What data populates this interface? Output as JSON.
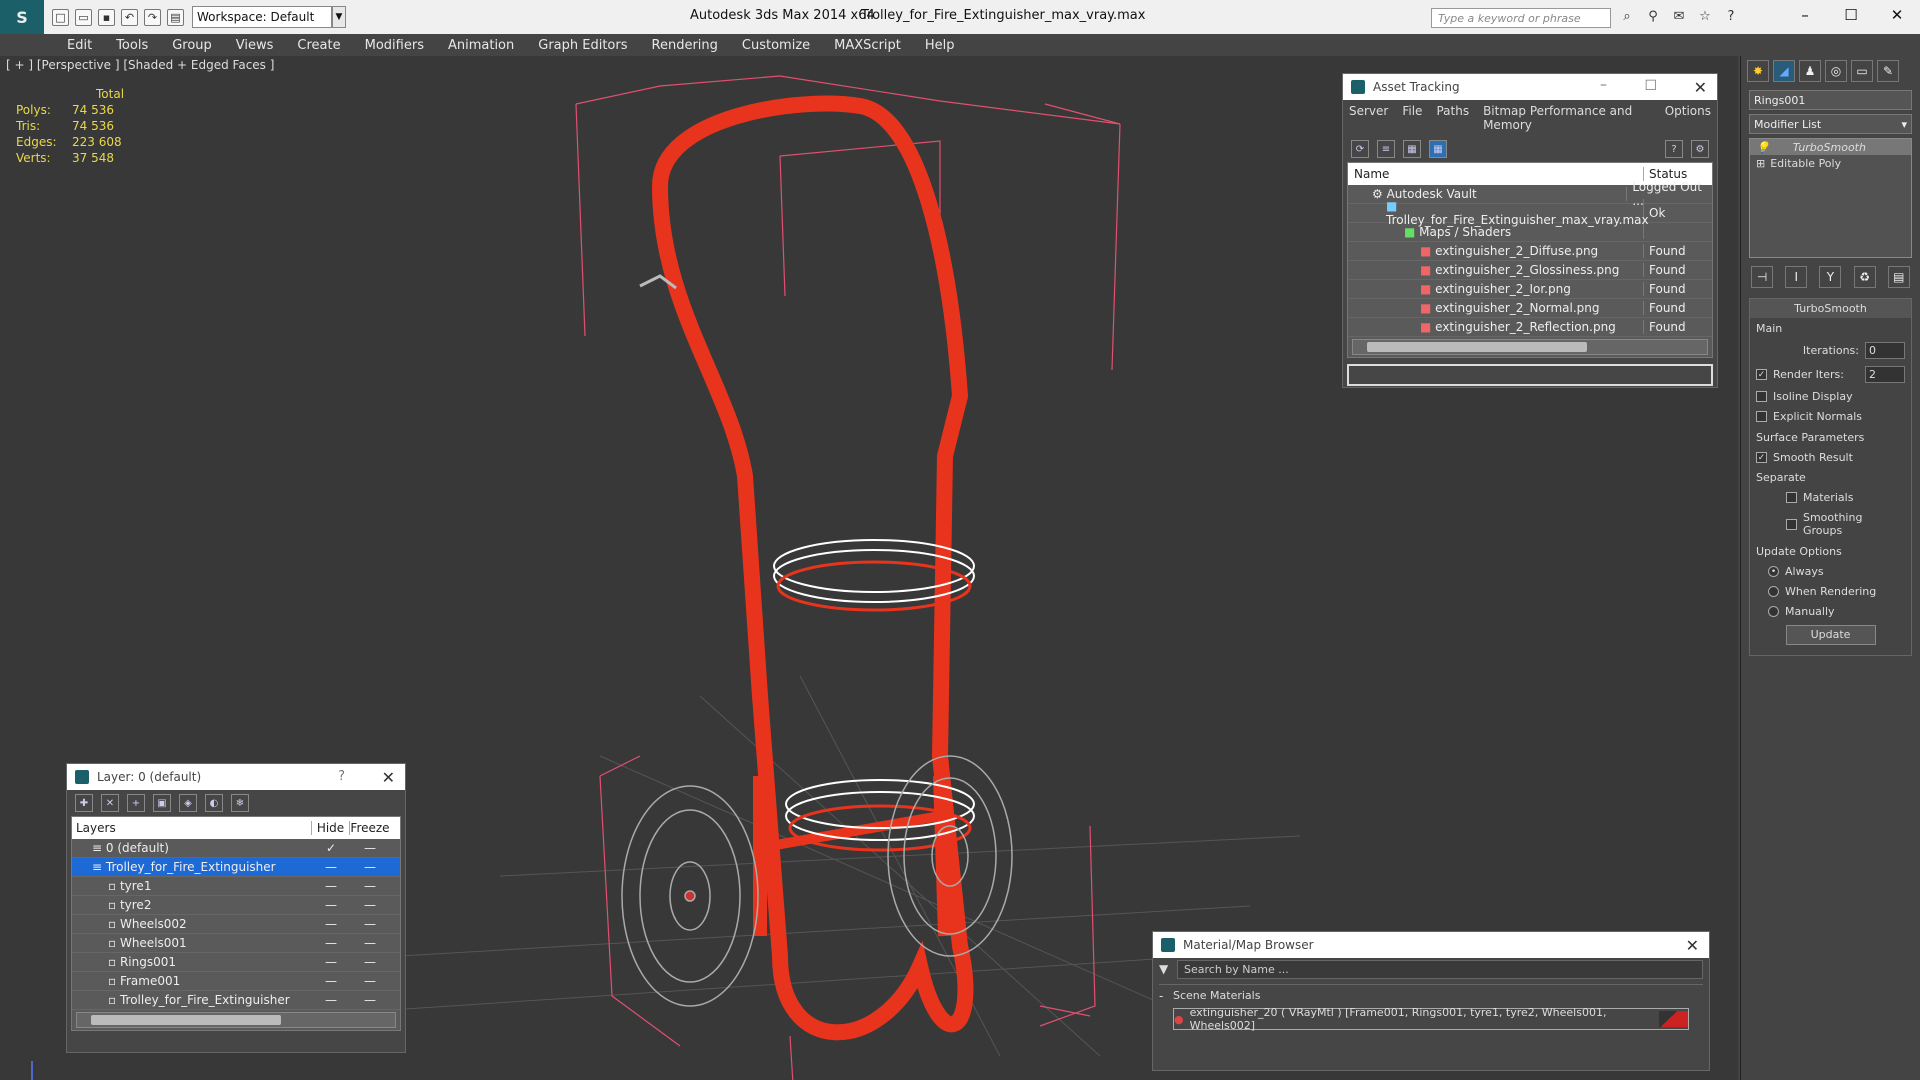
{
  "titlebar": {
    "app": "Autodesk 3ds Max  2014 x64",
    "file": "Trolley_for_Fire_Extinguisher_max_vray.max",
    "workspace": "Workspace: Default",
    "search_placeholder": "Type a keyword or phrase"
  },
  "menu": [
    "Edit",
    "Tools",
    "Group",
    "Views",
    "Create",
    "Modifiers",
    "Animation",
    "Graph Editors",
    "Rendering",
    "Customize",
    "MAXScript",
    "Help"
  ],
  "viewport": {
    "label": "[ + ] [Perspective ] [Shaded + Edged Faces ]",
    "stats": {
      "header": "Total",
      "polys_label": "Polys:",
      "polys": "74 536",
      "tris_label": "Tris:",
      "tris": "74 536",
      "edges_label": "Edges:",
      "edges": "223 608",
      "verts_label": "Verts:",
      "verts": "37 548"
    }
  },
  "asset_tracking": {
    "title": "Asset Tracking",
    "menu": [
      "Server",
      "File",
      "Paths",
      "Bitmap Performance and Memory",
      "Options"
    ],
    "col_name": "Name",
    "col_status": "Status",
    "rows": [
      {
        "name": "Autodesk Vault",
        "status": "Logged Out ..."
      },
      {
        "name": "Trolley_for_Fire_Extinguisher_max_vray.max",
        "status": "Ok"
      },
      {
        "name": "Maps / Shaders",
        "status": ""
      },
      {
        "name": "extinguisher_2_Diffuse.png",
        "status": "Found"
      },
      {
        "name": "extinguisher_2_Glossiness.png",
        "status": "Found"
      },
      {
        "name": "extinguisher_2_Ior.png",
        "status": "Found"
      },
      {
        "name": "extinguisher_2_Normal.png",
        "status": "Found"
      },
      {
        "name": "extinguisher_2_Reflection.png",
        "status": "Found"
      }
    ]
  },
  "layer": {
    "title": "Layer: 0 (default)",
    "q": "?",
    "col_layers": "Layers",
    "col_hide": "Hide",
    "col_freeze": "Freeze",
    "rows": [
      {
        "name": "0 (default)"
      },
      {
        "name": "Trolley_for_Fire_Extinguisher"
      },
      {
        "name": "tyre1"
      },
      {
        "name": "tyre2"
      },
      {
        "name": "Wheels002"
      },
      {
        "name": "Wheels001"
      },
      {
        "name": "Rings001"
      },
      {
        "name": "Frame001"
      },
      {
        "name": "Trolley_for_Fire_Extinguisher"
      }
    ]
  },
  "material_browser": {
    "title": "Material/Map Browser",
    "search_placeholder": "Search by Name ...",
    "section": "Scene Materials",
    "item": "extinguisher_20  ( VRayMtl )  [Frame001, Rings001, tyre1, tyre2, Wheels001, Wheels002]"
  },
  "command_panel": {
    "object_name": "Rings001",
    "modifier_list": "Modifier List",
    "stack": [
      "TurboSmooth",
      "Editable Poly"
    ],
    "turbosmooth": {
      "title": "TurboSmooth",
      "main": "Main",
      "iterations_label": "Iterations:",
      "iterations": "0",
      "render_iters_label": "Render Iters:",
      "render_iters": "2",
      "isoline": "Isoline Display",
      "explicit": "Explicit Normals",
      "surface": "Surface Parameters",
      "smooth": "Smooth Result",
      "separate": "Separate",
      "materials": "Materials",
      "smoothing": "Smoothing Groups",
      "update_options": "Update Options",
      "always": "Always",
      "when_rendering": "When Rendering",
      "manually": "Manually",
      "update_btn": "Update"
    }
  }
}
